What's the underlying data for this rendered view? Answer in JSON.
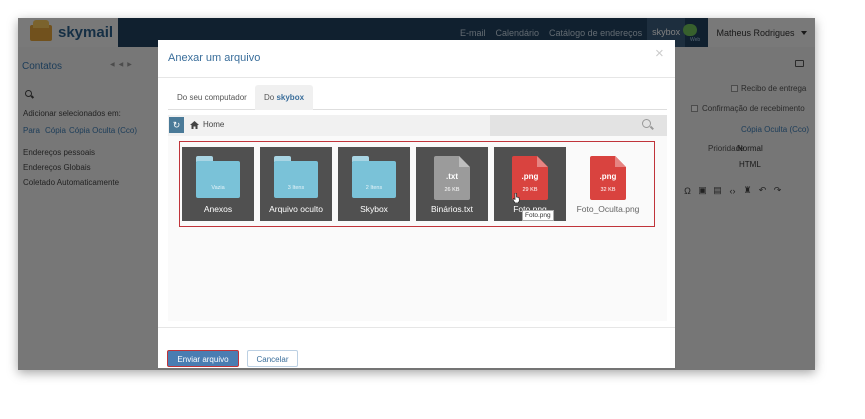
{
  "app": {
    "logo_text": "skymail",
    "nav": [
      "E-mail",
      "Calendário",
      "Catálogo de endereços",
      "skybox"
    ],
    "chat_label": "Web",
    "user_name": "Matheus Rodrigues"
  },
  "left": {
    "title": "Contatos",
    "add_selected": "Adicionar selecionados em:",
    "recipients": [
      "Para",
      "Cópia",
      "Cópia Oculta (Cco)"
    ],
    "address_books": [
      "Endereços pessoais",
      "Endereços Globais",
      "Coletado Automaticamente"
    ]
  },
  "right": {
    "options": [
      "Recibo de entrega",
      "Confirmação de recebimento"
    ],
    "bcc_link": "Cópia Oculta (Cco)",
    "priority_label": "Prioridade",
    "priority_value": "Normal",
    "format_value": "HTML"
  },
  "modal": {
    "title": "Anexar um arquivo",
    "close_glyph": "×",
    "tabs": [
      {
        "label": "Do seu computador"
      },
      {
        "label_prefix": "Do ",
        "label_bold": "skybox"
      }
    ],
    "refresh_glyph": "↻",
    "breadcrumb": "Home",
    "search_placeholder": "",
    "items": [
      {
        "kind": "folder",
        "name": "Anexos",
        "count": "Vazia"
      },
      {
        "kind": "folder",
        "name": "Arquivo oculto",
        "count": "3 Itens"
      },
      {
        "kind": "folder",
        "name": "Skybox",
        "count": "2 Itens"
      },
      {
        "kind": "file",
        "name": "Binários.txt",
        "ext": ".txt",
        "size": "26 KB",
        "color": "#9b9b9b"
      },
      {
        "kind": "file",
        "name": "Foto.png",
        "ext": ".png",
        "size": "29 KB",
        "color": "#d9433f"
      },
      {
        "kind": "file",
        "name": "Foto_Oculta.png",
        "ext": ".png",
        "size": "32 KB",
        "color": "#d9433f"
      }
    ],
    "tooltip": "Foto.png",
    "send_button": "Enviar arquivo",
    "cancel_button": "Cancelar"
  },
  "colors": {
    "accent": "#3a6e9b",
    "selection_border": "#c0343a",
    "folder": "#7ac2d8",
    "png": "#d9433f",
    "txt": "#9b9b9b"
  }
}
